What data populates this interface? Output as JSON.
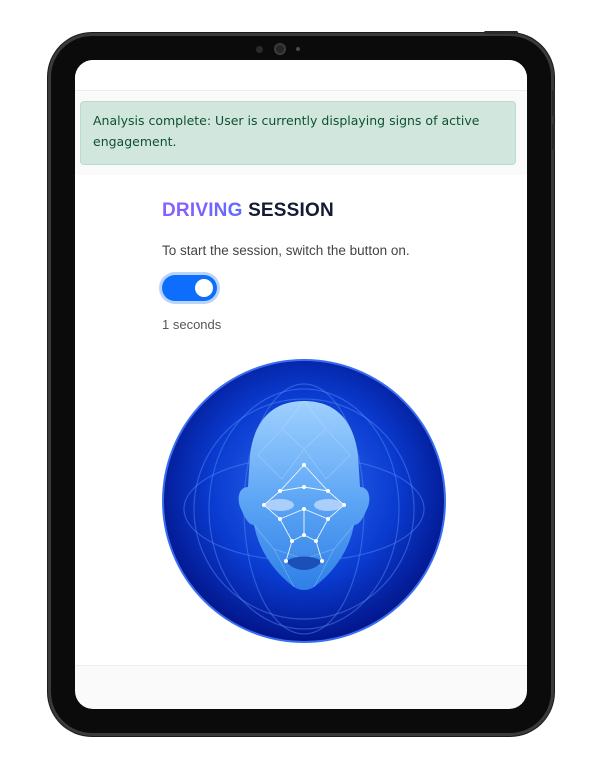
{
  "alert": {
    "line1": "Analysis complete: User is currently displaying signs of active",
    "line2": "engagement."
  },
  "session": {
    "title_part1": "DRIVING",
    "title_part2": "SESSION",
    "instruction": "To start the session, switch the button on.",
    "toggle_on": true,
    "elapsed": "1 seconds"
  },
  "colors": {
    "accent": "#0d6efd",
    "alert_bg": "#d1e7dd",
    "alert_text": "#0f5132",
    "title_gradient_start": "#8e5cff",
    "title_dark": "#141a33"
  },
  "illustration": {
    "icon": "face-scan-icon"
  }
}
